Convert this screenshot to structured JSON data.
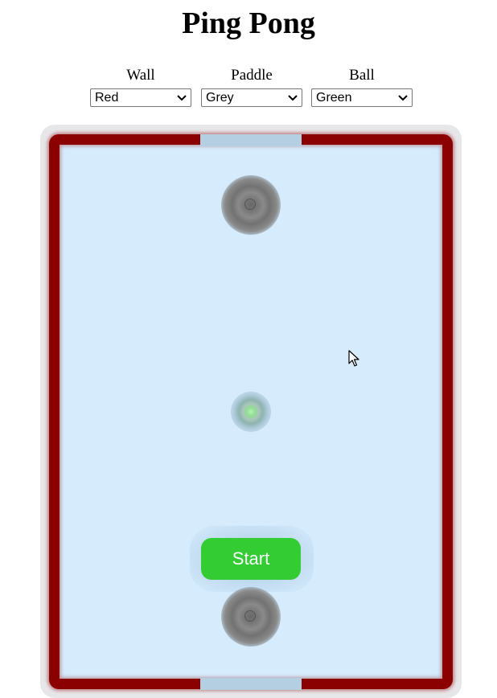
{
  "page": {
    "title": "Ping Pong"
  },
  "controls": {
    "wall": {
      "label": "Wall",
      "selected": "Red"
    },
    "paddle": {
      "label": "Paddle",
      "selected": "Grey"
    },
    "ball": {
      "label": "Ball",
      "selected": "Green"
    }
  },
  "game": {
    "start_label": "Start",
    "colors": {
      "wall": "#8b0000",
      "court": "#d6ecfd",
      "paddle": "#7a7a7a",
      "ball": "#8fe08f",
      "start_button": "#33cc33"
    }
  },
  "icons": {
    "dropdown": "chevron-down-icon",
    "pointer": "mouse-pointer-icon"
  }
}
